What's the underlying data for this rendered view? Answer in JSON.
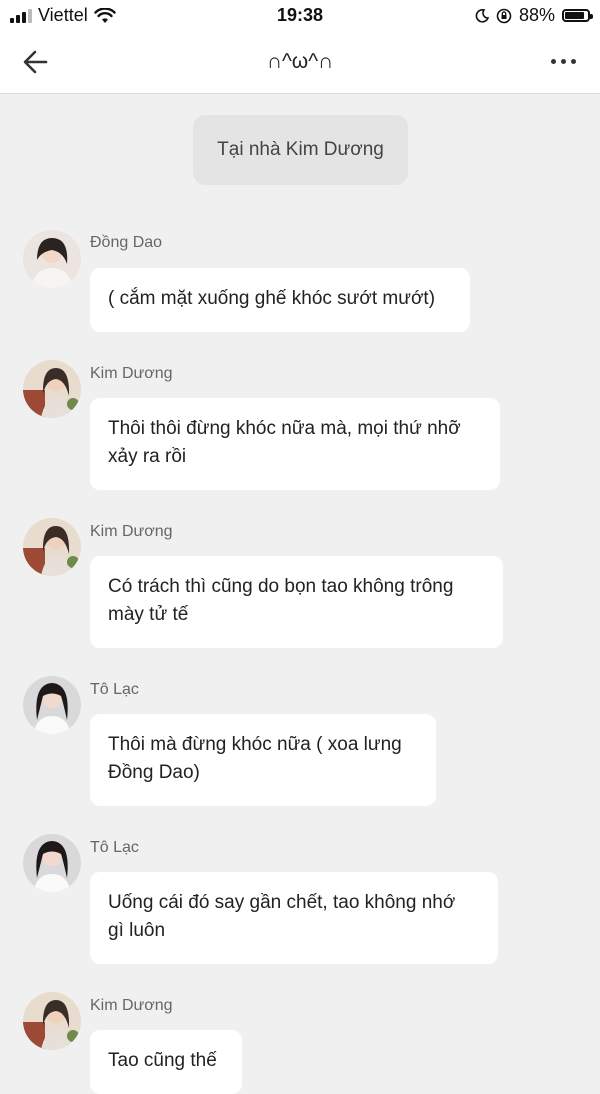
{
  "status_bar": {
    "carrier": "Viettel",
    "time": "19:38",
    "battery_percent": "88%",
    "battery_level": 0.88,
    "icons": [
      "signal-icon",
      "wifi-icon",
      "moon-icon",
      "orientation-lock-icon",
      "battery-icon"
    ]
  },
  "header": {
    "title": "∩^ω^∩",
    "back_icon": "arrow-left-icon",
    "more_icon": "more-dots-icon"
  },
  "system_message": "Tại nhà Kim Dương",
  "messages": [
    {
      "sender": "Đồng Dao",
      "text": "( cắm mặt xuống ghế khóc sướt mướt)"
    },
    {
      "sender": "Kim Dương",
      "text": "Thôi thôi đừng khóc nữa mà, mọi thứ nhỡ\nxảy ra rồi"
    },
    {
      "sender": "Kim Dương",
      "text": "Có trách thì cũng do bọn tao không trông\nmày tử tế"
    },
    {
      "sender": "Tô Lạc",
      "text": "Thôi mà đừng khóc nữa ( xoa lưng\nĐồng Dao)"
    },
    {
      "sender": "Tô Lạc",
      "text": "Uống cái đó say gần chết, tao không nhớ\ngì luôn"
    },
    {
      "sender": "Kim Dương",
      "text": "Tao cũng thế"
    }
  ],
  "colors": {
    "background": "#f0f0f0",
    "bubble": "#ffffff",
    "system_pill": "#e4e4e4",
    "sender_text": "#666666"
  }
}
